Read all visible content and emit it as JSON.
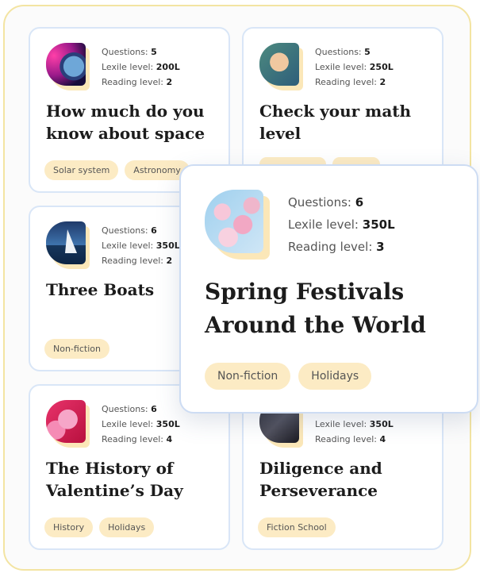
{
  "labels": {
    "questions": "Questions:",
    "lexile": "Lexile level:",
    "reading": "Reading level:"
  },
  "cards": [
    {
      "questions": "5",
      "lexile": "200L",
      "reading": "2",
      "title": "How much do you know about space",
      "tags": [
        "Solar system",
        "Astronomy"
      ],
      "image": "space-planet-image"
    },
    {
      "questions": "5",
      "lexile": "250L",
      "reading": "2",
      "title": "Check your math level",
      "tags": [],
      "image": "child-with-glasses-image"
    },
    {
      "questions": "6",
      "lexile": "350L",
      "reading": "2",
      "title": "Three Boats",
      "tags": [
        "Non-fiction"
      ],
      "image": "sailboat-image"
    },
    {
      "questions": "",
      "lexile": "350L",
      "reading": "4",
      "title": "Diligence and Perseverance",
      "tags": [
        "Fiction School"
      ],
      "image": "student-studying-image"
    },
    {
      "questions": "6",
      "lexile": "350L",
      "reading": "4",
      "title": "The History of Valentine’s Day",
      "tags": [
        "History",
        "Holidays"
      ],
      "image": "heart-candies-image"
    }
  ],
  "featured": {
    "questions": "6",
    "lexile": "350L",
    "reading": "3",
    "title": "Spring Festivals Around the World",
    "tags": [
      "Non-fiction",
      "Holidays"
    ],
    "image": "cherry-blossom-image"
  }
}
